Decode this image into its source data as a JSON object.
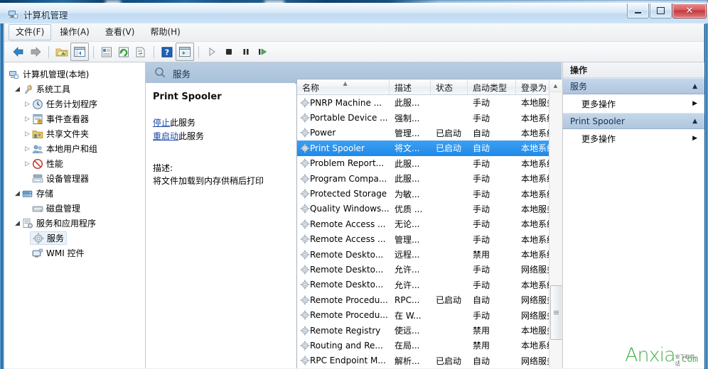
{
  "window": {
    "title": "计算机管理",
    "icon": "computer-management-icon",
    "minimize_label": "最小化",
    "maximize_label": "最大化",
    "close_label": "关闭"
  },
  "menu": {
    "items": [
      {
        "label": "文件(F)",
        "active": true
      },
      {
        "label": "操作(A)",
        "active": false
      },
      {
        "label": "查看(V)",
        "active": false
      },
      {
        "label": "帮助(H)",
        "active": false
      }
    ]
  },
  "toolbar": {
    "buttons": [
      {
        "name": "back-icon",
        "glyph": "back"
      },
      {
        "name": "forward-icon",
        "glyph": "forward"
      },
      {
        "name": "separator",
        "glyph": "sep"
      },
      {
        "name": "folder-up-icon",
        "glyph": "folder"
      },
      {
        "name": "show-hide-tree-icon",
        "glyph": "tree"
      },
      {
        "name": "separator",
        "glyph": "sep"
      },
      {
        "name": "properties-icon",
        "glyph": "props"
      },
      {
        "name": "refresh-icon",
        "glyph": "refresh"
      },
      {
        "name": "export-list-icon",
        "glyph": "export"
      },
      {
        "name": "separator",
        "glyph": "sep"
      },
      {
        "name": "help-icon",
        "glyph": "help"
      },
      {
        "name": "console-view-icon",
        "glyph": "console"
      },
      {
        "name": "separator",
        "glyph": "sep"
      },
      {
        "name": "start-service-icon",
        "glyph": "play"
      },
      {
        "name": "stop-service-icon",
        "glyph": "stop"
      },
      {
        "name": "pause-service-icon",
        "glyph": "pause"
      },
      {
        "name": "restart-service-icon",
        "glyph": "restart"
      }
    ]
  },
  "tree": {
    "root": {
      "label": "计算机管理(本地)",
      "icon": "computer-icon"
    },
    "nodes": [
      {
        "label": "系统工具",
        "icon": "system-tools-icon",
        "indent": 1,
        "twist": "open",
        "selected": false
      },
      {
        "label": "任务计划程序",
        "icon": "task-scheduler-icon",
        "indent": 2,
        "twist": "closed",
        "selected": false
      },
      {
        "label": "事件查看器",
        "icon": "event-viewer-icon",
        "indent": 2,
        "twist": "closed",
        "selected": false
      },
      {
        "label": "共享文件夹",
        "icon": "shared-folders-icon",
        "indent": 2,
        "twist": "closed",
        "selected": false
      },
      {
        "label": "本地用户和组",
        "icon": "local-users-icon",
        "indent": 2,
        "twist": "closed",
        "selected": false
      },
      {
        "label": "性能",
        "icon": "performance-icon",
        "indent": 2,
        "twist": "closed",
        "selected": false
      },
      {
        "label": "设备管理器",
        "icon": "device-manager-icon",
        "indent": 2,
        "twist": "none",
        "selected": false
      },
      {
        "label": "存储",
        "icon": "storage-icon",
        "indent": 1,
        "twist": "open",
        "selected": false
      },
      {
        "label": "磁盘管理",
        "icon": "disk-management-icon",
        "indent": 2,
        "twist": "none",
        "selected": false
      },
      {
        "label": "服务和应用程序",
        "icon": "services-apps-icon",
        "indent": 1,
        "twist": "open",
        "selected": false
      },
      {
        "label": "服务",
        "icon": "services-icon",
        "indent": 2,
        "twist": "none",
        "selected": true
      },
      {
        "label": "WMI 控件",
        "icon": "wmi-control-icon",
        "indent": 2,
        "twist": "none",
        "selected": false
      }
    ]
  },
  "middle": {
    "header": {
      "label": "服务",
      "icon": "services-header-icon"
    },
    "detail": {
      "service_name": "Print Spooler",
      "stop_link": "停止",
      "stop_suffix": "此服务",
      "restart_link": "重启动",
      "restart_suffix": "此服务",
      "description_label": "描述:",
      "description_text": "将文件加载到内存供稍后打印"
    },
    "list": {
      "columns": [
        {
          "label": "名称",
          "width": 130,
          "sorted": "asc"
        },
        {
          "label": "描述",
          "width": 58,
          "sorted": ""
        },
        {
          "label": "状态",
          "width": 52,
          "sorted": ""
        },
        {
          "label": "启动类型",
          "width": 68,
          "sorted": ""
        },
        {
          "label": "登录为",
          "width": 64,
          "sorted": ""
        }
      ],
      "rows": [
        {
          "name": "PNRP Machine ...",
          "desc": "此服...",
          "status": "",
          "startup": "手动",
          "logon": "本地服务",
          "selected": false
        },
        {
          "name": "Portable Device ...",
          "desc": "强制...",
          "status": "",
          "startup": "手动",
          "logon": "本地系统",
          "selected": false
        },
        {
          "name": "Power",
          "desc": "管理...",
          "status": "已启动",
          "startup": "自动",
          "logon": "本地系统",
          "selected": false
        },
        {
          "name": "Print Spooler",
          "desc": "将文...",
          "status": "已启动",
          "startup": "自动",
          "logon": "本地系统",
          "selected": true
        },
        {
          "name": "Problem Report...",
          "desc": "此服...",
          "status": "",
          "startup": "手动",
          "logon": "本地系统",
          "selected": false
        },
        {
          "name": "Program Compa...",
          "desc": "此服...",
          "status": "",
          "startup": "手动",
          "logon": "本地系统",
          "selected": false
        },
        {
          "name": "Protected Storage",
          "desc": "为敏...",
          "status": "",
          "startup": "手动",
          "logon": "本地系统",
          "selected": false
        },
        {
          "name": "Quality Windows...",
          "desc": "优质 ...",
          "status": "",
          "startup": "手动",
          "logon": "本地服务",
          "selected": false
        },
        {
          "name": "Remote Access ...",
          "desc": "无论...",
          "status": "",
          "startup": "手动",
          "logon": "本地系统",
          "selected": false
        },
        {
          "name": "Remote Access ...",
          "desc": "管理...",
          "status": "",
          "startup": "手动",
          "logon": "本地系统",
          "selected": false
        },
        {
          "name": "Remote Deskto...",
          "desc": "远程...",
          "status": "",
          "startup": "禁用",
          "logon": "本地系统",
          "selected": false
        },
        {
          "name": "Remote Deskto...",
          "desc": "允许...",
          "status": "",
          "startup": "手动",
          "logon": "网络服务",
          "selected": false
        },
        {
          "name": "Remote Deskto...",
          "desc": "允许...",
          "status": "",
          "startup": "手动",
          "logon": "本地系统",
          "selected": false
        },
        {
          "name": "Remote Procedu...",
          "desc": "RPC...",
          "status": "已启动",
          "startup": "自动",
          "logon": "网络服务",
          "selected": false
        },
        {
          "name": "Remote Procedu...",
          "desc": "在 W...",
          "status": "",
          "startup": "手动",
          "logon": "网络服务",
          "selected": false
        },
        {
          "name": "Remote Registry",
          "desc": "使远...",
          "status": "",
          "startup": "禁用",
          "logon": "本地服务",
          "selected": false
        },
        {
          "name": "Routing and Re...",
          "desc": "在局...",
          "status": "",
          "startup": "禁用",
          "logon": "本地系统",
          "selected": false
        },
        {
          "name": "RPC Endpoint M...",
          "desc": "解析...",
          "status": "已启动",
          "startup": "自动",
          "logon": "网络服务",
          "selected": false
        }
      ]
    }
  },
  "actions": {
    "title": "操作",
    "groups": [
      {
        "header": "服务",
        "items": [
          {
            "label": "更多操作",
            "submenu": true
          }
        ]
      },
      {
        "header": "Print Spooler",
        "items": [
          {
            "label": "更多操作",
            "submenu": true
          }
        ]
      }
    ]
  },
  "watermark": {
    "main": "Anxia",
    "domain": ".com",
    "sub": "安下软件站"
  },
  "colors": {
    "selection": "#1f8aea",
    "link": "#1a49a8",
    "header_blue": "#afc6de",
    "watermark_green": "#4cb050"
  }
}
